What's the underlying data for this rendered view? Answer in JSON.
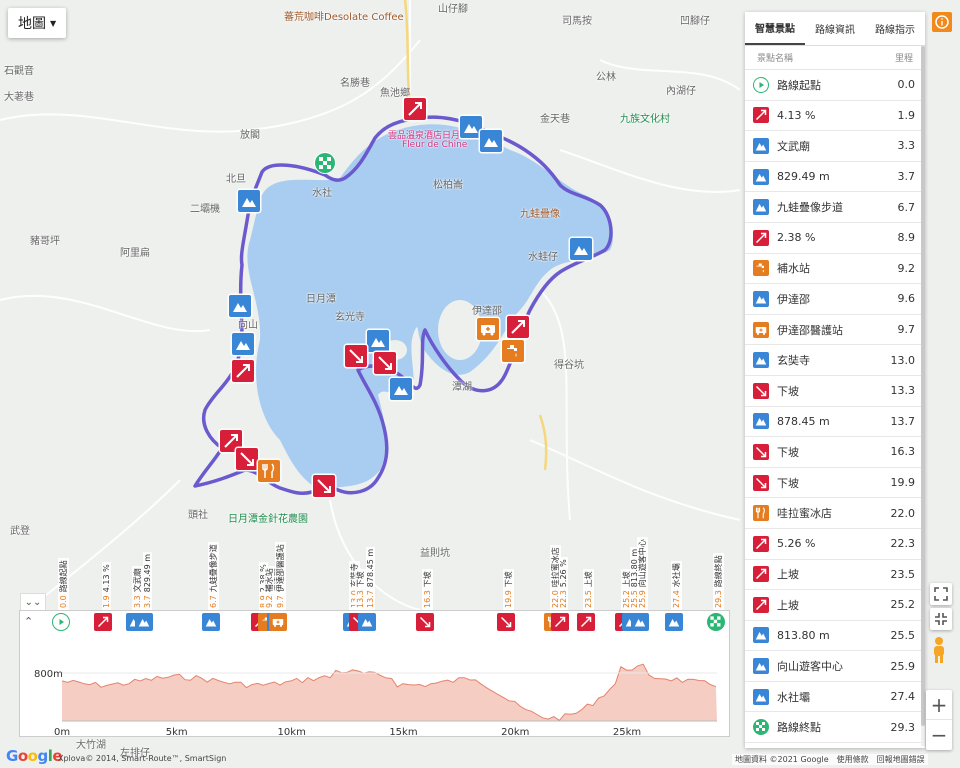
{
  "map": {
    "type_button": "地圖",
    "labels": [
      {
        "t": "魚池鄉"
      },
      {
        "t": "名勝巷"
      },
      {
        "t": "山仔腳"
      },
      {
        "t": "司馬按"
      },
      {
        "t": "公林"
      },
      {
        "t": "內湖仔"
      },
      {
        "t": "金天巷"
      },
      {
        "t": "松柏崙"
      },
      {
        "t": "放閣"
      },
      {
        "t": "北旦"
      },
      {
        "t": "水社"
      },
      {
        "t": "二壩機"
      },
      {
        "t": "豬哥坪"
      },
      {
        "t": "阿里扁"
      },
      {
        "t": "大荖巷"
      },
      {
        "t": "石觀音"
      },
      {
        "t": "向山"
      },
      {
        "t": "日月潭"
      },
      {
        "t": "玄光寺"
      },
      {
        "t": "水蛙仔"
      },
      {
        "t": "得谷坑"
      },
      {
        "t": "潭湖"
      },
      {
        "t": "頭社"
      },
      {
        "t": "武登"
      },
      {
        "t": "益則坑"
      },
      {
        "t": "大竹湖"
      },
      {
        "t": "左排仔"
      },
      {
        "t": "九族文化村"
      },
      {
        "t": "凹腳仔"
      },
      {
        "t": "蕃荒咖啡Desolate Coffee"
      },
      {
        "t": "雲品溫泉酒店日月潭"
      },
      {
        "t": "Fleur de Chine"
      },
      {
        "t": "九蛙疊像"
      },
      {
        "t": "日月潭金針花農園"
      },
      {
        "t": "伊達邵"
      }
    ]
  },
  "panel": {
    "tabs": [
      "智慧景點",
      "路線資訊",
      "路線指示"
    ],
    "header_name": "景點名稱",
    "header_dist": "里程",
    "rows": [
      {
        "icon": "start-icon",
        "color": "start",
        "name": "路線起點",
        "km": "0.0"
      },
      {
        "icon": "steep-up-icon",
        "color": "red",
        "name": "4.13 %",
        "km": "1.9"
      },
      {
        "icon": "mountain-icon",
        "color": "blue",
        "name": "文武廟",
        "km": "3.3"
      },
      {
        "icon": "mountain-icon",
        "color": "blue",
        "name": "829.49 m",
        "km": "3.7"
      },
      {
        "icon": "mountain-icon",
        "color": "blue",
        "name": "九蛙疊像步道",
        "km": "6.7"
      },
      {
        "icon": "steep-up-icon",
        "color": "red",
        "name": "2.38 %",
        "km": "8.9"
      },
      {
        "icon": "water-tap-icon",
        "color": "orange",
        "name": "補水站",
        "km": "9.2"
      },
      {
        "icon": "mountain-icon",
        "color": "blue",
        "name": "伊達邵",
        "km": "9.6"
      },
      {
        "icon": "ambulance-icon",
        "color": "orange",
        "name": "伊達邵醫護站",
        "km": "9.7"
      },
      {
        "icon": "mountain-icon",
        "color": "blue",
        "name": "玄奘寺",
        "km": "13.0"
      },
      {
        "icon": "steep-down-icon",
        "color": "red",
        "name": "下坡",
        "km": "13.3"
      },
      {
        "icon": "mountain-icon",
        "color": "blue",
        "name": "878.45 m",
        "km": "13.7"
      },
      {
        "icon": "steep-down-icon",
        "color": "red",
        "name": "下坡",
        "km": "16.3"
      },
      {
        "icon": "steep-down-icon",
        "color": "red",
        "name": "下坡",
        "km": "19.9"
      },
      {
        "icon": "food-icon",
        "color": "orange",
        "name": "哇拉蜜冰店",
        "km": "22.0"
      },
      {
        "icon": "steep-up-icon",
        "color": "red",
        "name": "5.26 %",
        "km": "22.3"
      },
      {
        "icon": "steep-up-icon",
        "color": "red",
        "name": "上坡",
        "km": "23.5"
      },
      {
        "icon": "steep-up-icon",
        "color": "red",
        "name": "上坡",
        "km": "25.2"
      },
      {
        "icon": "mountain-icon",
        "color": "blue",
        "name": "813.80 m",
        "km": "25.5"
      },
      {
        "icon": "mountain-icon",
        "color": "blue",
        "name": "向山遊客中心",
        "km": "25.9"
      },
      {
        "icon": "mountain-icon",
        "color": "blue",
        "name": "水社壩",
        "km": "27.4"
      },
      {
        "icon": "finish-icon",
        "color": "finish",
        "name": "路線終點",
        "km": "29.3"
      }
    ]
  },
  "profile": {
    "y_label": "800m",
    "x_ticks": [
      "0m",
      "5km",
      "10km",
      "15km",
      "20km",
      "25km"
    ],
    "total_km": 29.3,
    "waypoint_labels": [
      {
        "km": "0.0",
        "name": "路線起點"
      },
      {
        "km": "1.9",
        "name": "4.13 %"
      },
      {
        "km": "3.3",
        "name": "文武廟"
      },
      {
        "km": "3.7",
        "name": "829.49 m"
      },
      {
        "km": "6.7",
        "name": "九蛙疊像步道"
      },
      {
        "km": "8.9",
        "name": "2.38 %"
      },
      {
        "km": "9.2",
        "name": "補水站"
      },
      {
        "km": "9.6",
        "name": "伊達邵"
      },
      {
        "km": "9.7",
        "name": "伊達邵醫護站"
      },
      {
        "km": "13.0",
        "name": "玄奘寺"
      },
      {
        "km": "13.3",
        "name": "下坡"
      },
      {
        "km": "13.7",
        "name": "878.45 m"
      },
      {
        "km": "16.3",
        "name": "下坡"
      },
      {
        "km": "19.9",
        "name": "下坡"
      },
      {
        "km": "22.0",
        "name": "哇拉蜜冰店"
      },
      {
        "km": "22.3",
        "name": "5.26 %"
      },
      {
        "km": "23.5",
        "name": "上坡"
      },
      {
        "km": "25.2",
        "name": "上坡"
      },
      {
        "km": "25.5",
        "name": "813.80 m"
      },
      {
        "km": "25.9",
        "name": "向山遊客中心"
      },
      {
        "km": "27.4",
        "name": "水社壩"
      },
      {
        "km": "29.3",
        "name": "路線終點"
      }
    ]
  },
  "footer": {
    "google": [
      "G",
      "o",
      "o",
      "g",
      "l",
      "e"
    ],
    "attribution": "Xplova© 2014, Smart-Route™, SmartSign",
    "map_data": "地圖資料 ©2021 Google",
    "terms": "使用條款",
    "report": "回報地圖錯誤"
  },
  "colors": {
    "route": "#6a5acd",
    "lake": "#a8cdf0",
    "red_marker": "#d81f3a",
    "blue_marker": "#3a86d6",
    "orange_marker": "#e57c1f",
    "profile_fill": "#f6cdc3",
    "profile_line": "#e3836e"
  }
}
